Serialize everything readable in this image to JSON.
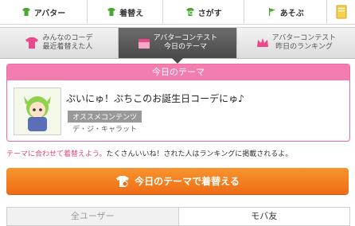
{
  "topnav": {
    "items": [
      {
        "label": "アバター",
        "icon": "shirt-icon"
      },
      {
        "label": "着替え",
        "icon": "shirt-icon"
      },
      {
        "label": "さがす",
        "icon": "search-shirt-icon"
      },
      {
        "label": "あそぶ",
        "icon": "flag-icon"
      },
      {
        "label": "",
        "icon": "notebook-icon"
      }
    ]
  },
  "tabs": [
    {
      "line1": "みんなのコーデ",
      "line2": "最近着替えた人"
    },
    {
      "line1": "アバターコンテスト",
      "line2": "今日のテーマ"
    },
    {
      "line1": "アバターコンテスト",
      "line2": "昨日のランキング"
    }
  ],
  "theme": {
    "header": "今日のテーマ",
    "title": "ぷいにゅ！ぷちこのお誕生日コーデにゅ♪",
    "badge": "オススメコンテンツ",
    "brand": "デ・ジ・キャラット"
  },
  "note": {
    "pink": "テーマに合わせて着替えよう。",
    "rest": "たくさんいいね！された人はランキングに掲載されるよ。"
  },
  "cta": {
    "label": "今日のテーマで着替える"
  },
  "bottom_tabs": [
    "全ユーザー",
    "モバ友"
  ],
  "colors": {
    "pink": "#f47db0",
    "orange": "#ef6c14",
    "green": "#4aa830"
  }
}
